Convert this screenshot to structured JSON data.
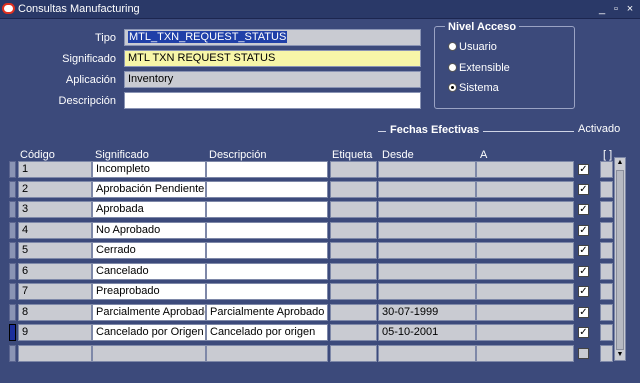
{
  "window": {
    "title": "Consultas Manufacturing",
    "minimize": "_",
    "restore": "▫",
    "close": "×"
  },
  "header": {
    "tipo_label": "Tipo",
    "tipo_value": "MTL_TXN_REQUEST_STATUS",
    "significado_label": "Significado",
    "significado_value": "MTL TXN REQUEST STATUS",
    "aplicacion_label": "Aplicación",
    "aplicacion_value": "Inventory",
    "descripcion_label": "Descripción",
    "descripcion_value": ""
  },
  "nivel_acceso": {
    "title": "Nivel Acceso",
    "options": [
      {
        "label": "Usuario",
        "selected": false
      },
      {
        "label": "Extensible",
        "selected": false
      },
      {
        "label": "Sistema",
        "selected": true
      }
    ]
  },
  "fechas_efectivas_title": "Fechas Efectivas",
  "activado_label": "Activado",
  "brackets_label": "[ ]",
  "columns": {
    "codigo": "Código",
    "significado": "Significado",
    "descripcion": "Descripción",
    "etiqueta": "Etiqueta",
    "desde": "Desde",
    "a": "A"
  },
  "rows": [
    {
      "codigo": "1",
      "significado": "Incompleto",
      "descripcion": "",
      "etiqueta": "",
      "desde": "",
      "a": "",
      "activado": "✓"
    },
    {
      "codigo": "2",
      "significado": "Aprobación Pendiente",
      "descripcion": "",
      "etiqueta": "",
      "desde": "",
      "a": "",
      "activado": "✓"
    },
    {
      "codigo": "3",
      "significado": "Aprobada",
      "descripcion": "",
      "etiqueta": "",
      "desde": "",
      "a": "",
      "activado": "✓"
    },
    {
      "codigo": "4",
      "significado": "No Aprobado",
      "descripcion": "",
      "etiqueta": "",
      "desde": "",
      "a": "",
      "activado": "✓"
    },
    {
      "codigo": "5",
      "significado": "Cerrado",
      "descripcion": "",
      "etiqueta": "",
      "desde": "",
      "a": "",
      "activado": "✓"
    },
    {
      "codigo": "6",
      "significado": "Cancelado",
      "descripcion": "",
      "etiqueta": "",
      "desde": "",
      "a": "",
      "activado": "✓"
    },
    {
      "codigo": "7",
      "significado": "Preaprobado",
      "descripcion": "",
      "etiqueta": "",
      "desde": "",
      "a": "",
      "activado": "✓"
    },
    {
      "codigo": "8",
      "significado": "Parcialmente Aprobado",
      "descripcion": "Parcialmente Aprobado",
      "etiqueta": "",
      "desde": "30-07-1999",
      "a": "",
      "activado": "✓"
    },
    {
      "codigo": "9",
      "significado": "Cancelado por Origen",
      "descripcion": "Cancelado por origen",
      "etiqueta": "",
      "desde": "05-10-2001",
      "a": "",
      "activado": "✓"
    },
    {
      "codigo": "",
      "significado": "",
      "descripcion": "",
      "etiqueta": "",
      "desde": "",
      "a": "",
      "activado": ""
    }
  ],
  "colors": {
    "background": "#3c4a7b",
    "titlebar": "#2a3968",
    "field_gray": "#c9cbd2",
    "field_yellow": "#f7f6a8",
    "selection": "#2040a8",
    "current_row_marker": "#1b2e9c"
  }
}
